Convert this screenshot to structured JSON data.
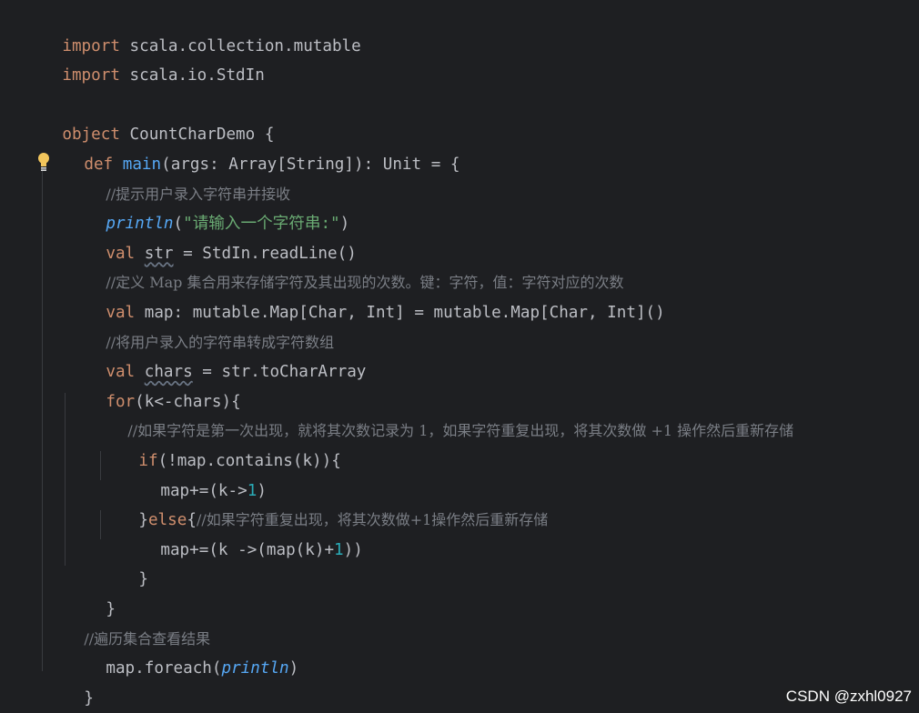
{
  "lines": [
    [
      "import",
      " scala.collection.mutable"
    ],
    [
      "import",
      " scala.io.StdIn"
    ],
    [],
    [
      "object",
      " CountCharDemo {"
    ],
    [
      "def",
      " ",
      "main",
      "(args: Array[String]): Unit = {"
    ],
    [
      "//提示用户录入字符串并接收"
    ],
    [
      "println",
      "(",
      "\"请输入一个字符串:\"",
      ")"
    ],
    [
      "val",
      " ",
      "str",
      " = StdIn.readLine()"
    ],
    [
      "//定义 Map 集合用来存储字符及其出现的次数。键：字符，值：字符对应的次数"
    ],
    [
      "val",
      " map: mutable.Map[Char, Int] = mutable.Map[Char, Int]()"
    ],
    [
      "//将用户录入的字符串转成字符数组"
    ],
    [
      "val",
      " ",
      "chars",
      " = str.toCharArray"
    ],
    [
      "for",
      "(k<-chars){"
    ],
    [
      "//如果字符是第一次出现，就将其次数记录为 1，如果字符重复出现，将其次数做 +1 操作然后重新存储"
    ],
    [
      "if",
      "(!map.contains(k)){"
    ],
    [
      "map+=(k->",
      "1",
      ")"
    ],
    [
      "}",
      "else",
      "{",
      "//如果字符重复出现，将其次数做+1操作然后重新存储"
    ],
    [
      "map+=(k ->(map(k)+",
      "1",
      "))"
    ],
    [
      "}"
    ],
    [
      "}"
    ],
    [
      "//遍历集合查看结果"
    ],
    [
      "map.foreach(",
      "println",
      ")"
    ],
    [
      "}"
    ],
    [
      "}"
    ]
  ],
  "watermark": "CSDN @zxhl0927",
  "colors": {
    "background": "#1e1f22",
    "keyword": "#cf8e6d",
    "function": "#56a8f5",
    "string": "#6aab73",
    "number": "#2aacb8",
    "comment": "#7a7e85",
    "text": "#bcbec4"
  },
  "icons": {
    "intention_bulb": "lightbulb-icon"
  }
}
